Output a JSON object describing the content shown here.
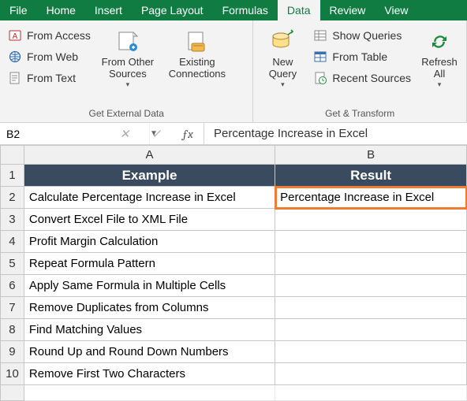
{
  "tabs": {
    "file": "File",
    "home": "Home",
    "insert": "Insert",
    "pagelayout": "Page Layout",
    "formulas": "Formulas",
    "data": "Data",
    "review": "Review",
    "view": "View"
  },
  "ribbon": {
    "group1": {
      "access": "From Access",
      "web": "From Web",
      "text": "From Text",
      "other_sources": "From Other\nSources",
      "existing": "Existing\nConnections",
      "label": "Get External Data"
    },
    "group2": {
      "newquery": "New\nQuery",
      "showq": "Show Queries",
      "fromtable": "From Table",
      "recent": "Recent Sources",
      "refresh": "Refresh\nAll",
      "label": "Get & Transform"
    }
  },
  "formula_bar": {
    "name": "B2",
    "value": "Percentage Increase in Excel"
  },
  "columns": {
    "A": "A",
    "B": "B"
  },
  "headers": {
    "A": "Example",
    "B": "Result"
  },
  "rows": [
    {
      "n": "1"
    },
    {
      "n": "2",
      "A": "Calculate Percentage Increase in Excel",
      "B": "Percentage Increase in Excel"
    },
    {
      "n": "3",
      "A": "Convert Excel File to XML File",
      "B": ""
    },
    {
      "n": "4",
      "A": "Profit Margin Calculation",
      "B": ""
    },
    {
      "n": "5",
      "A": "Repeat Formula Pattern",
      "B": ""
    },
    {
      "n": "6",
      "A": "Apply Same Formula in Multiple Cells",
      "B": ""
    },
    {
      "n": "7",
      "A": "Remove Duplicates from Columns",
      "B": ""
    },
    {
      "n": "8",
      "A": "Find Matching Values",
      "B": ""
    },
    {
      "n": "9",
      "A": "Round Up and Round Down Numbers",
      "B": ""
    },
    {
      "n": "10",
      "A": "Remove First Two Characters",
      "B": ""
    }
  ]
}
